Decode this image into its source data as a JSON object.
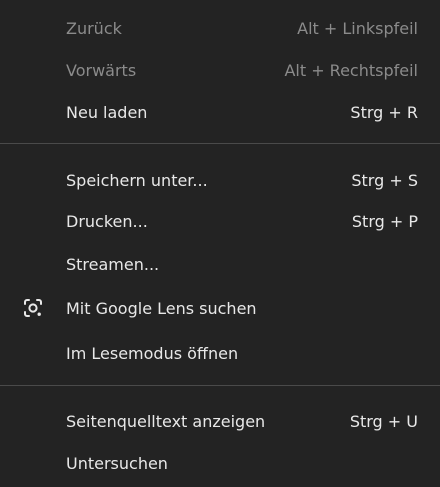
{
  "menu": {
    "items": [
      {
        "label": "Zurück",
        "shortcut": "Alt + Linkspfeil"
      },
      {
        "label": "Vorwärts",
        "shortcut": "Alt + Rechtspfeil"
      },
      {
        "label": "Neu laden",
        "shortcut": "Strg + R"
      },
      {
        "label": "Speichern unter...",
        "shortcut": "Strg + S"
      },
      {
        "label": "Drucken...",
        "shortcut": "Strg + P"
      },
      {
        "label": "Streamen..."
      },
      {
        "label": "Mit Google Lens suchen",
        "icon": "google-lens-icon"
      },
      {
        "label": "Im Lesemodus öffnen"
      },
      {
        "label": "Seitenquelltext anzeigen",
        "shortcut": "Strg + U"
      },
      {
        "label": "Untersuchen"
      }
    ]
  },
  "colors": {
    "background": "#232323",
    "text": "#e8e8e8",
    "disabled_text": "#8b8b8b",
    "separator": "#4a4a4a"
  }
}
